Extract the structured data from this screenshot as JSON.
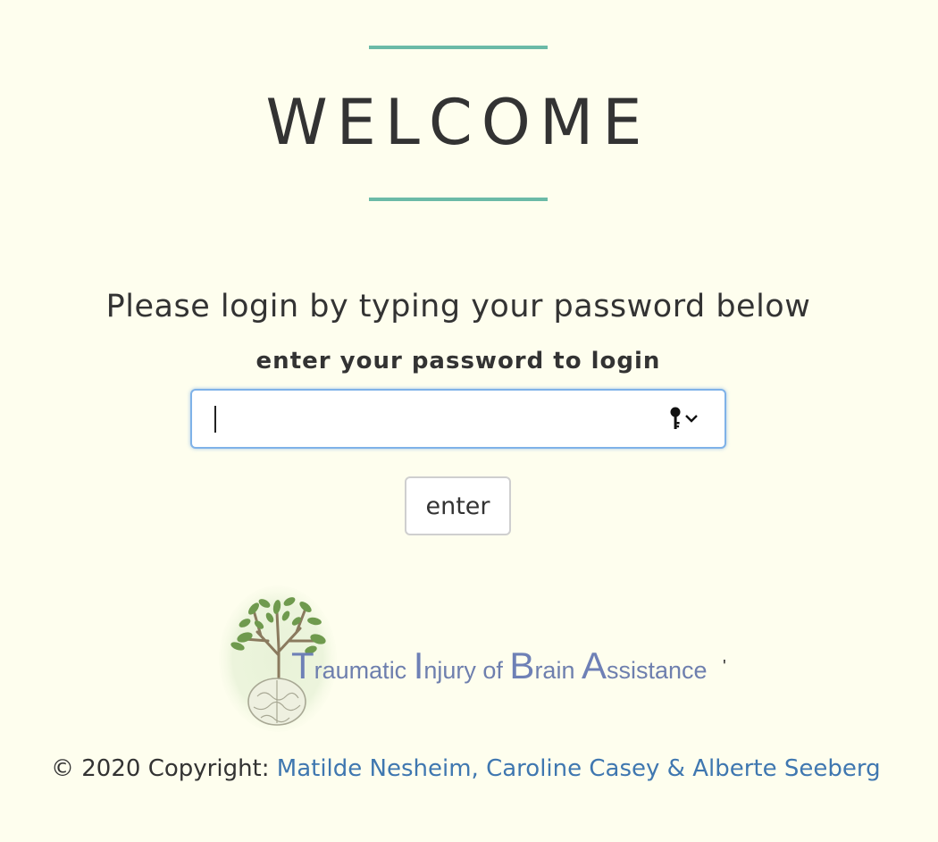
{
  "header": {
    "title": "WELCOME",
    "subtitle": "Please login by typing your password below"
  },
  "login": {
    "label": "enter your password to login",
    "password_value": "",
    "password_placeholder": "",
    "password_manager_icon": "key-icon",
    "submit_label": "enter"
  },
  "logo": {
    "parts": [
      {
        "big": "T",
        "rest": "raumatic "
      },
      {
        "big": "I",
        "rest": "njury of "
      },
      {
        "big": "B",
        "rest": "rain "
      },
      {
        "big": "A",
        "rest": "ssistance"
      }
    ],
    "trailing_mark": "'",
    "image": "tree-brain-logo"
  },
  "footer": {
    "copyright": "© 2020 Copyright: ",
    "authors": "Matilde Nesheim, Caroline Casey & Alberte Seeberg"
  },
  "colors": {
    "background": "#fefeee",
    "accent_rule": "#6bbaa7",
    "link": "#3f77b0",
    "logo_text": "#6e7fae"
  }
}
